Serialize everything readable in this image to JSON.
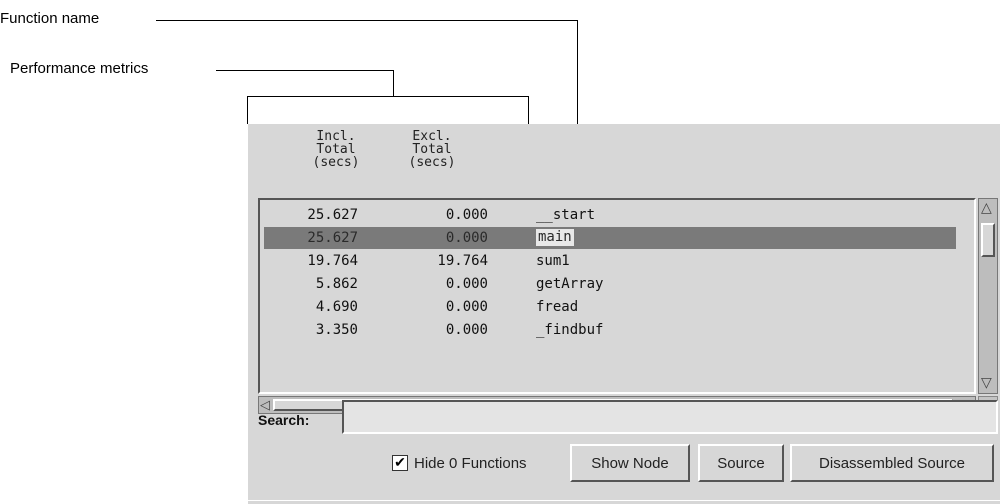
{
  "callouts": {
    "function_name": "Function name",
    "performance_metrics": "Performance metrics"
  },
  "columns": [
    {
      "line1": "Incl.",
      "line2": "Total",
      "line3": "(secs)"
    },
    {
      "line1": "Excl.",
      "line2": "Total",
      "line3": "(secs)"
    }
  ],
  "rows": [
    {
      "incl": "25.627",
      "excl": "0.000",
      "name": "__start"
    },
    {
      "incl": "25.627",
      "excl": "0.000",
      "name": "main"
    },
    {
      "incl": "19.764",
      "excl": "19.764",
      "name": "sum1"
    },
    {
      "incl": "5.862",
      "excl": "0.000",
      "name": "getArray"
    },
    {
      "incl": "4.690",
      "excl": "0.000",
      "name": "fread"
    },
    {
      "incl": "3.350",
      "excl": "0.000",
      "name": "_findbuf"
    }
  ],
  "selected_row": "main",
  "search": {
    "label": "Search:",
    "value": ""
  },
  "hide_zero": {
    "label": "Hide 0 Functions",
    "checked": true,
    "mark": "✔"
  },
  "buttons": {
    "show_node": "Show Node",
    "source": "Source",
    "disassembled_source": "Disassembled Source"
  },
  "icons": {
    "up": "△",
    "down": "▽",
    "left": "◁",
    "right": "▷"
  }
}
